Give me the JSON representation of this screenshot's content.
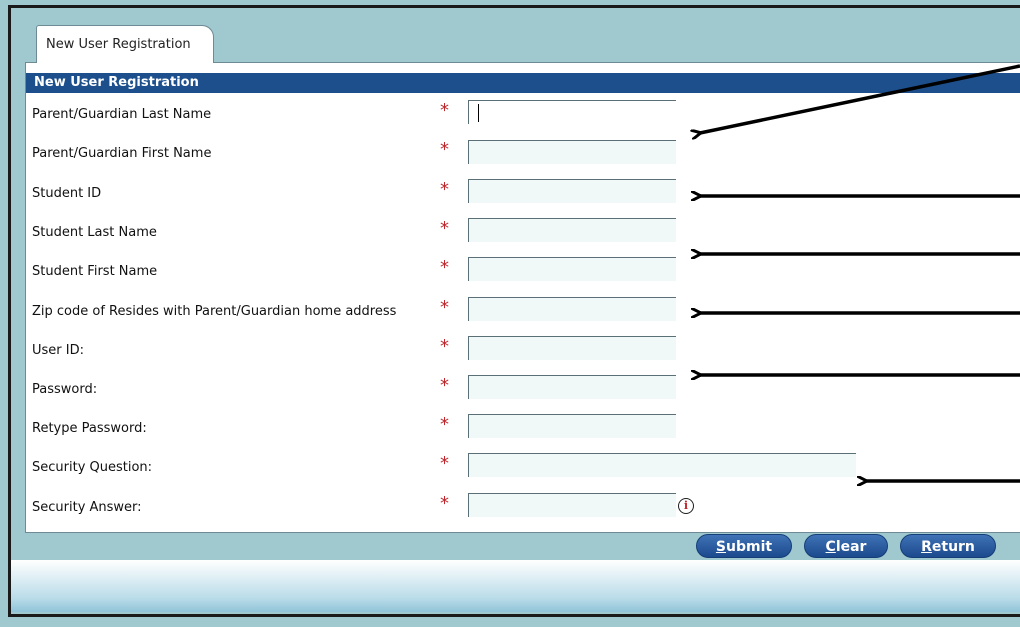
{
  "tab": {
    "label": "New User Registration"
  },
  "panel": {
    "title": "New User Registration"
  },
  "required_marker": "*",
  "fields": [
    {
      "label": "Parent/Guardian Last Name",
      "value": ""
    },
    {
      "label": "Parent/Guardian First Name",
      "value": ""
    },
    {
      "label": "Student ID",
      "value": ""
    },
    {
      "label": "Student Last Name",
      "value": ""
    },
    {
      "label": "Student First Name",
      "value": ""
    },
    {
      "label": "Zip code of Resides with Parent/Guardian home address",
      "value": ""
    },
    {
      "label": "User ID:",
      "value": ""
    },
    {
      "label": "Password:",
      "value": ""
    },
    {
      "label": "Retype Password:",
      "value": ""
    },
    {
      "label": "Security Question:",
      "value": ""
    },
    {
      "label": "Security Answer:",
      "value": ""
    }
  ],
  "info_icon": {
    "glyph": "i",
    "icon": "info-icon"
  },
  "buttons": {
    "submit": {
      "access_key": "S",
      "rest": "ubmit"
    },
    "clear": {
      "access_key": "C",
      "rest": "lear"
    },
    "return": {
      "access_key": "R",
      "rest": "eturn"
    }
  },
  "colors": {
    "header_bg": "#1c4f8c",
    "required": "#c0262c",
    "button": "#2a5da0",
    "page_bg": "#9fc8cf"
  }
}
